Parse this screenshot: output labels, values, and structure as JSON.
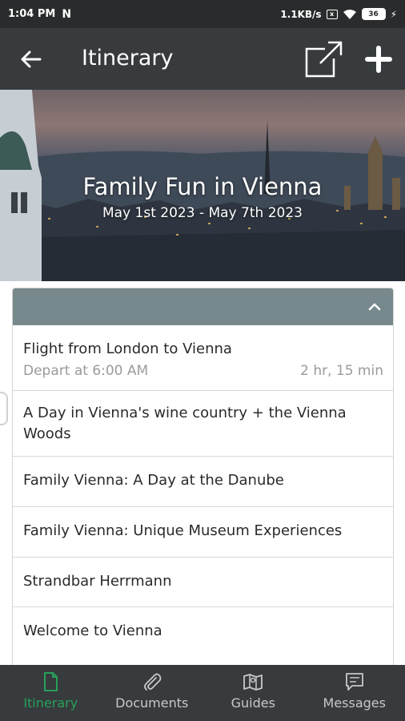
{
  "status_bar": {
    "time": "1:04 PM",
    "network_speed": "1.1KB/s",
    "battery_level": "36"
  },
  "app_bar": {
    "title": "Itinerary",
    "back_icon": "arrow-left-icon",
    "share_icon": "external-link-icon",
    "add_icon": "plus-icon"
  },
  "hero": {
    "title": "Family Fun in Vienna",
    "dates": "May 1st 2023 - May 7th 2023"
  },
  "itinerary": {
    "collapse_icon": "chevron-up-icon",
    "items": [
      {
        "title": "Flight from London to Vienna",
        "subtitle": "Depart at 6:00 AM",
        "duration": "2 hr, 15 min"
      },
      {
        "title": "A Day in Vienna's wine country + the Vienna Woods"
      },
      {
        "title": "Family Vienna: A Day at the Danube"
      },
      {
        "title": "Family Vienna: Unique Museum Experiences"
      },
      {
        "title": "Strandbar Herrmann"
      },
      {
        "title": "Welcome to Vienna"
      }
    ]
  },
  "bottom_nav": {
    "tabs": [
      {
        "label": "Itinerary",
        "icon": "document-icon",
        "active": true
      },
      {
        "label": "Documents",
        "icon": "paperclip-icon",
        "active": false
      },
      {
        "label": "Guides",
        "icon": "map-icon",
        "active": false
      },
      {
        "label": "Messages",
        "icon": "chat-icon",
        "active": false
      }
    ]
  },
  "colors": {
    "app_bar": "#373b3d",
    "card_header": "#77898d",
    "active_tab": "#27a05a"
  }
}
